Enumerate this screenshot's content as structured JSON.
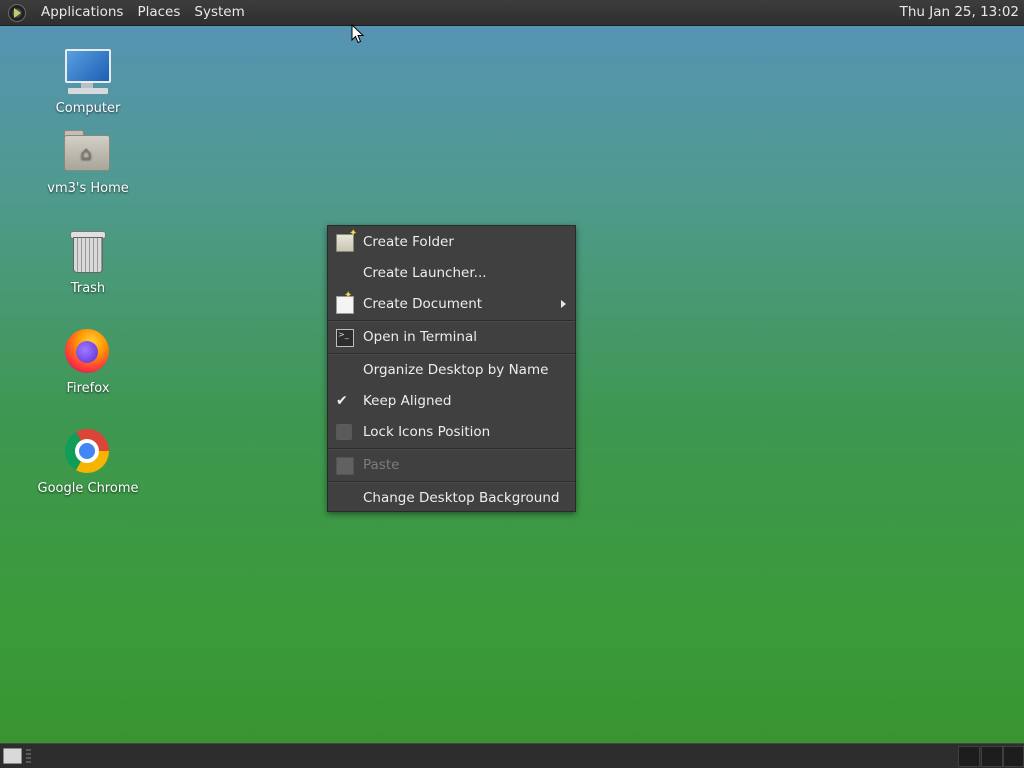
{
  "top_panel": {
    "menus": [
      "Applications",
      "Places",
      "System"
    ],
    "clock": "Thu Jan 25, 13:02"
  },
  "desktop_icons": [
    {
      "label": "Computer",
      "icon": "computer-icon"
    },
    {
      "label": "vm3's Home",
      "icon": "home-folder-icon"
    },
    {
      "label": "Trash",
      "icon": "trash-icon"
    },
    {
      "label": "Firefox",
      "icon": "firefox-icon"
    },
    {
      "label": "Google Chrome",
      "icon": "chrome-icon"
    }
  ],
  "context_menu": {
    "items": [
      {
        "label": "Create Folder",
        "icon": "folder-new-icon",
        "enabled": true
      },
      {
        "label": "Create Launcher...",
        "icon": "",
        "enabled": true
      },
      {
        "label": "Create Document",
        "icon": "document-new-icon",
        "enabled": true,
        "submenu": true
      },
      {
        "label": "Open in Terminal",
        "icon": "terminal-icon",
        "enabled": true
      },
      {
        "label": "Organize Desktop by Name",
        "icon": "",
        "enabled": true
      },
      {
        "label": "Keep Aligned",
        "icon": "checkmark-icon",
        "enabled": true,
        "checked": true
      },
      {
        "label": "Lock Icons Position",
        "icon": "",
        "enabled": true,
        "checked": false
      },
      {
        "label": "Paste",
        "icon": "paste-icon",
        "enabled": false
      },
      {
        "label": "Change Desktop Background",
        "icon": "",
        "enabled": true
      }
    ]
  },
  "colors": {
    "panel": "#2f2f2f",
    "menu_bg": "#404040",
    "desktop_top": "#5792b9",
    "desktop_bottom": "#389430"
  }
}
